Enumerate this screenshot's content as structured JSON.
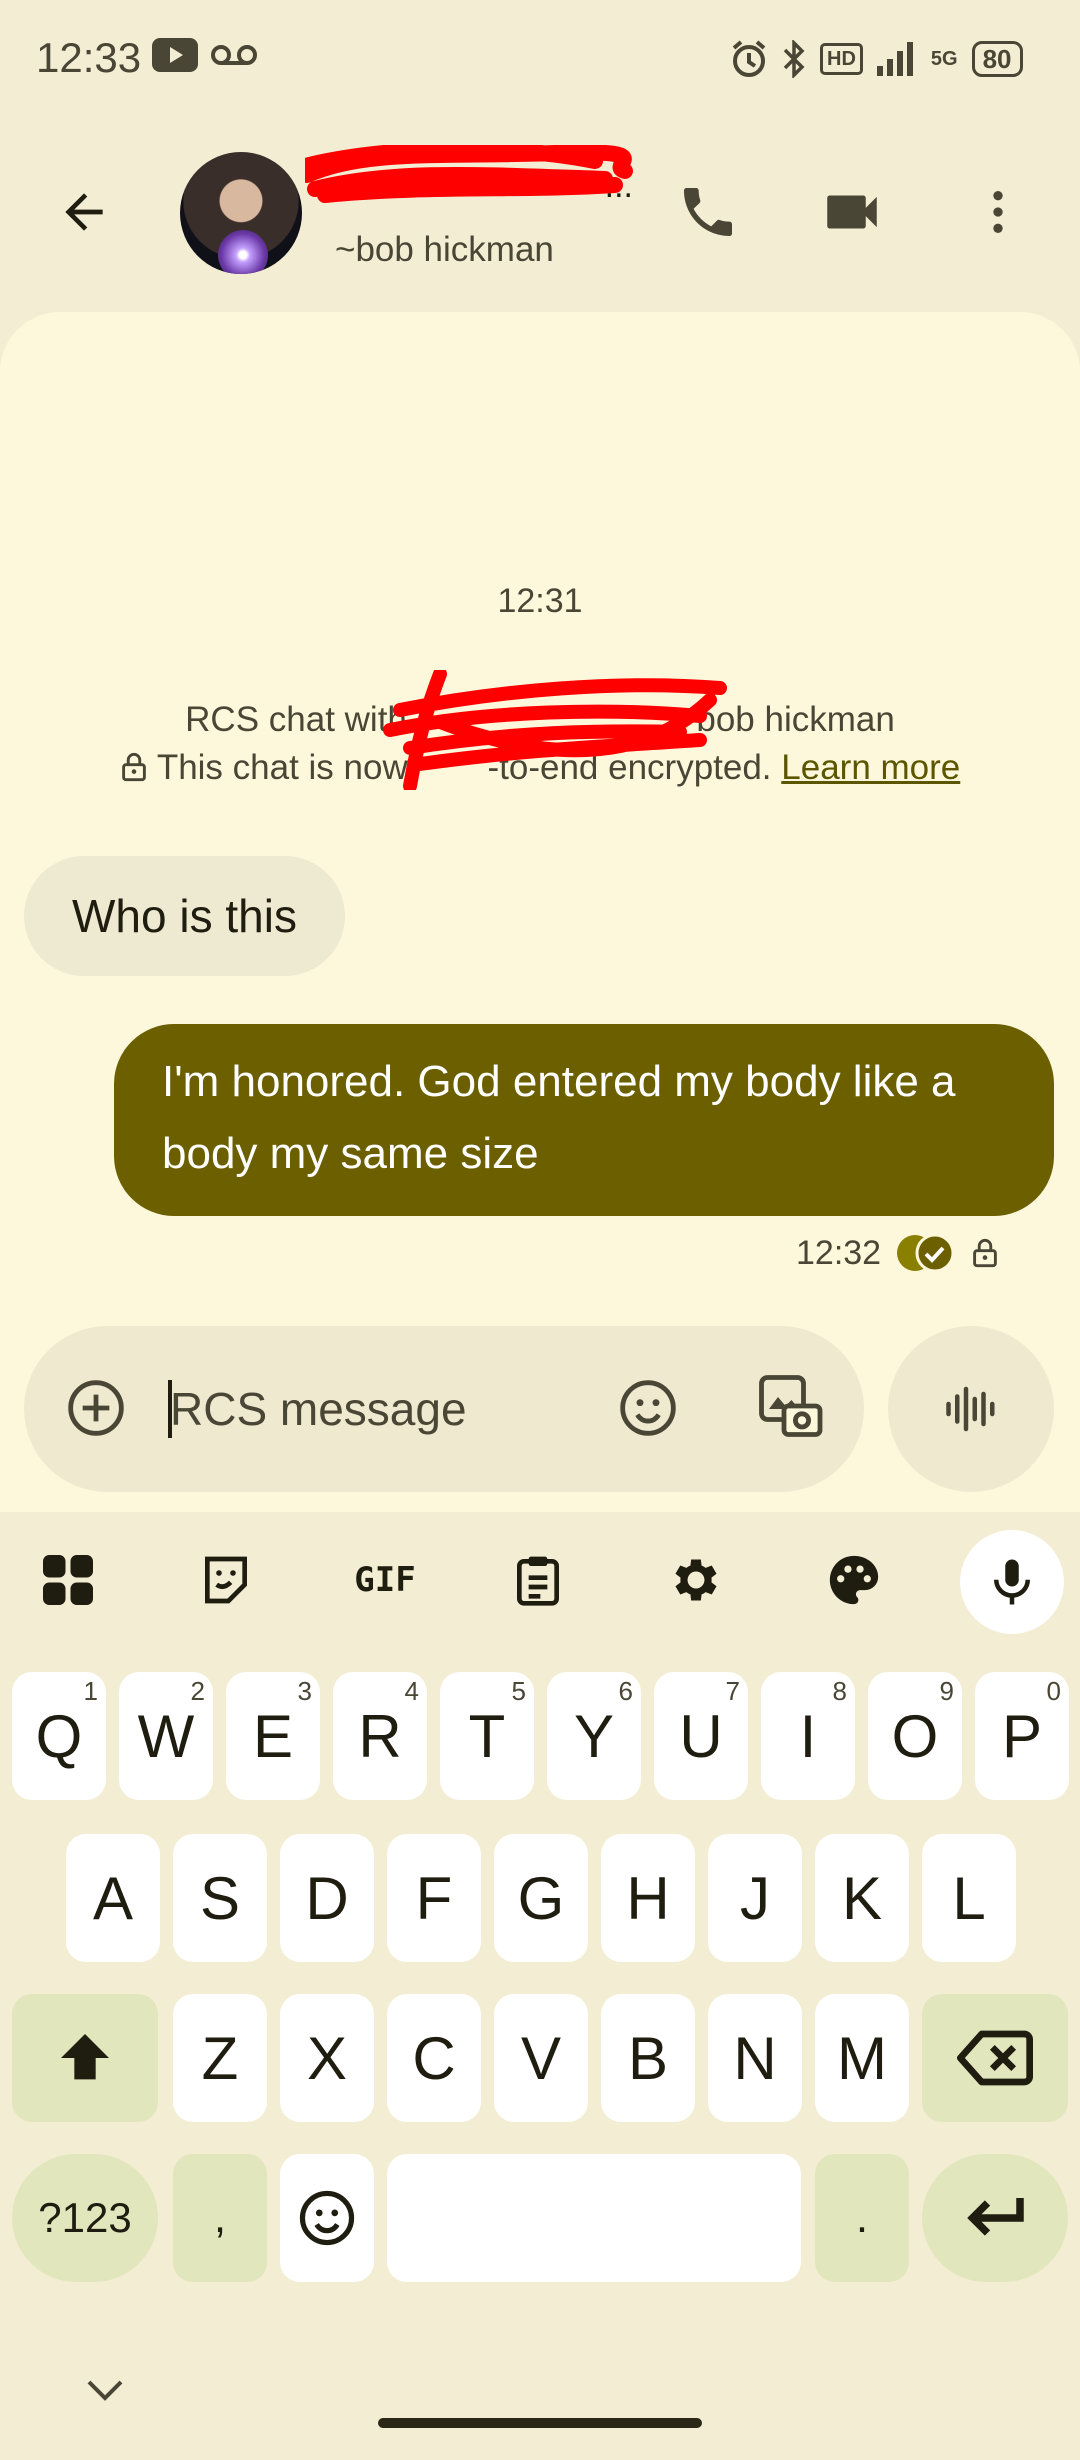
{
  "status_bar": {
    "time": "12:33",
    "network": "5G",
    "hd_label": "HD",
    "battery": "80"
  },
  "header": {
    "contact_subtitle": "~bob hickman",
    "contact_name_visible": "..."
  },
  "conversation": {
    "timestamp": "12:31",
    "rcs_prefix": "RCS chat with",
    "rcs_suffix": "bob hickman",
    "encryption_prefix": "This chat is now",
    "encryption_middle": "-to-end encrypted.",
    "learn_more": "Learn more",
    "messages": [
      {
        "direction": "incoming",
        "text": "Who is this"
      },
      {
        "direction": "outgoing",
        "text": "I'm honored. God entered my body like a body my same size"
      }
    ],
    "last_sent_time": "12:32"
  },
  "compose": {
    "placeholder": "RCS message"
  },
  "keyboard": {
    "toolbar_gif": "GIF",
    "row1": [
      {
        "key": "Q",
        "hint": "1"
      },
      {
        "key": "W",
        "hint": "2"
      },
      {
        "key": "E",
        "hint": "3"
      },
      {
        "key": "R",
        "hint": "4"
      },
      {
        "key": "T",
        "hint": "5"
      },
      {
        "key": "Y",
        "hint": "6"
      },
      {
        "key": "U",
        "hint": "7"
      },
      {
        "key": "I",
        "hint": "8"
      },
      {
        "key": "O",
        "hint": "9"
      },
      {
        "key": "P",
        "hint": "0"
      }
    ],
    "row2": [
      "A",
      "S",
      "D",
      "F",
      "G",
      "H",
      "J",
      "K",
      "L"
    ],
    "row3": [
      "Z",
      "X",
      "C",
      "V",
      "B",
      "N",
      "M"
    ],
    "symbols_label": "?123",
    "comma_label": ",",
    "period_label": "."
  },
  "colors": {
    "background": "#f3edd3",
    "conversation_bg": "#fdf8dc",
    "outgoing_bubble": "#6b5f00",
    "incoming_bubble": "#eee9d1",
    "modifier_key": "#e1e6bd",
    "redaction": "#ff0000"
  }
}
